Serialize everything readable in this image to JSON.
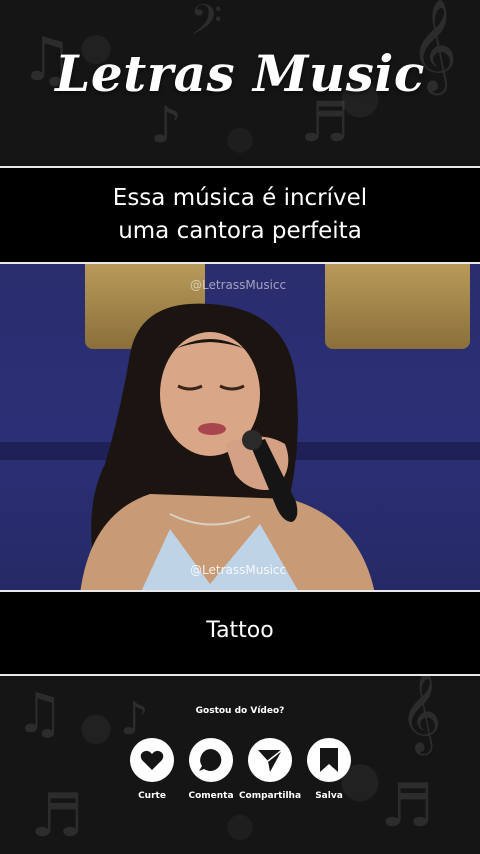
{
  "brand": {
    "title": "Letras Music"
  },
  "caption": {
    "line1": "Essa música é incrível",
    "line2": "uma cantora perfeita"
  },
  "video": {
    "watermark_top": "@LetrassMusicc",
    "watermark_mid": "@LetrassMusicc"
  },
  "song": {
    "title": "Tattoo"
  },
  "cta": {
    "title": "Gostou do Vídeo?",
    "actions": [
      {
        "label": "Curte",
        "icon": "heart-icon"
      },
      {
        "label": "Comenta",
        "icon": "comment-icon"
      },
      {
        "label": "Compartilha",
        "icon": "share-icon"
      },
      {
        "label": "Salva",
        "icon": "bookmark-icon"
      }
    ]
  },
  "colors": {
    "band": "#000000",
    "border": "#e8e8e8",
    "background": "#161616",
    "text": "#ffffff",
    "video_bg": "#2b2f76"
  }
}
